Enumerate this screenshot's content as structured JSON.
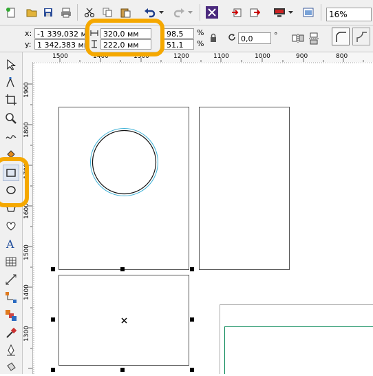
{
  "toolbar": {
    "zoom_value": "16%",
    "icons": [
      "new-document-icon",
      "open-folder-icon",
      "save-icon",
      "print-icon",
      "cut-icon",
      "copy-icon",
      "paste-icon",
      "undo-icon",
      "redo-icon",
      "import-icon",
      "export-icon",
      "publish-icon",
      "app-launcher-icon",
      "options-icon"
    ]
  },
  "properties": {
    "x_label": "x:",
    "x_value": "-1 339,032 мм",
    "y_label": "y:",
    "y_value": "1 342,383 мм",
    "width_value": "320,0 мм",
    "height_value": "222,0 мм",
    "scale_w": "98,5",
    "scale_h": "51,1",
    "percent_1": "%",
    "percent_2": "%",
    "angle_value": "0,0",
    "degree_sign": "°"
  },
  "hruler": {
    "ticks": [
      {
        "label": "1500"
      },
      {
        "label": "1400"
      },
      {
        "label": "1300"
      },
      {
        "label": "1200"
      },
      {
        "label": "1100"
      },
      {
        "label": "1000"
      },
      {
        "label": "900"
      },
      {
        "label": "800"
      }
    ]
  },
  "vruler": {
    "ticks": [
      {
        "label": "1900"
      },
      {
        "label": "1800"
      },
      {
        "label": "1700"
      },
      {
        "label": "1600"
      },
      {
        "label": "1500"
      },
      {
        "label": "1400"
      },
      {
        "label": "1300"
      }
    ]
  },
  "colors": {
    "highlight": "#f5a800",
    "circle_outline": "#3db1d6",
    "page_outline": "#0b8a5a"
  }
}
